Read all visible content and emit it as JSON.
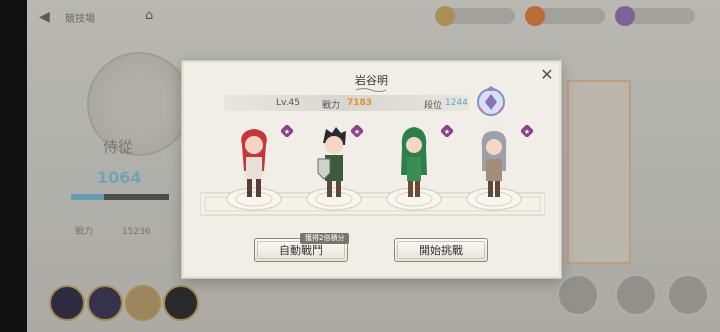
{
  "topbar": {
    "title": "競技場"
  },
  "left_panel": {
    "medal_name": "侍從",
    "medal_score": "1064",
    "power_label": "戰力",
    "power_value": "15236"
  },
  "colors": {
    "power": "#e0922f",
    "rank": "#58a9cc",
    "exp_bar": "#6fb9d1"
  },
  "modal": {
    "title": "岩谷明",
    "level": "Lv.45",
    "power_label": "戰力",
    "power_value": "7183",
    "rank_label": "段位",
    "rank_value": "1244",
    "tip": "獲得2倍積分",
    "auto_button": "自動戰鬥",
    "start_button": "開始挑戰",
    "close_icon": "close-icon"
  },
  "heroes": [
    {
      "name": "red-hair-hero",
      "hair": "#c8353a",
      "outfit": "#e6e0d8",
      "star": "#8e3d8f"
    },
    {
      "name": "shield-hero",
      "hair": "#2b2a33",
      "outfit": "#3c5a3f",
      "star": "#8e3d8f"
    },
    {
      "name": "green-hair-hero",
      "hair": "#2f7f4a",
      "outfit": "#3a8d55",
      "star": "#8e3d8f"
    },
    {
      "name": "silver-hair-hero",
      "hair": "#9aa1ab",
      "outfit": "#a38d78",
      "star": "#8e3d8f"
    }
  ]
}
